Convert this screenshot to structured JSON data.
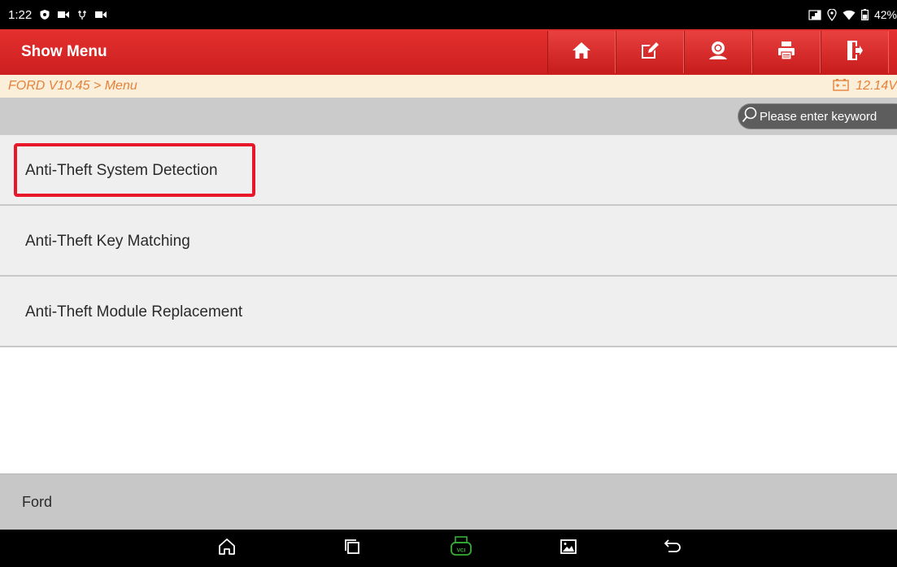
{
  "status_bar": {
    "time": "1:22",
    "battery": "42%"
  },
  "header": {
    "title": "Show Menu",
    "toolbar": [
      {
        "icon": "home-icon"
      },
      {
        "icon": "edit-icon"
      },
      {
        "icon": "user-icon"
      },
      {
        "icon": "print-icon"
      },
      {
        "icon": "exit-icon"
      }
    ]
  },
  "breadcrumb": {
    "path": "FORD V10.45 > Menu",
    "voltage": "12.14V"
  },
  "search": {
    "placeholder": "Please enter keyword"
  },
  "menu": {
    "items": [
      {
        "label": "Anti-Theft System Detection",
        "highlighted": true
      },
      {
        "label": "Anti-Theft Key Matching"
      },
      {
        "label": "Anti-Theft Module Replacement"
      }
    ]
  },
  "footer": {
    "text": "Ford"
  },
  "nav": {
    "vci_label": "VCI"
  },
  "colors": {
    "header_red": "#d9282a",
    "breadcrumb_orange": "#e5813a",
    "highlight_red": "#e8182a",
    "vci_green": "#35b035"
  }
}
